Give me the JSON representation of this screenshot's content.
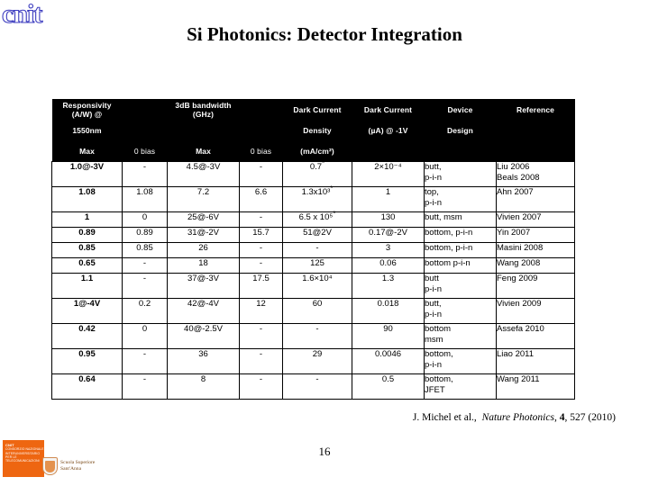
{
  "logo": {
    "brand_text": "cnit",
    "brand_color": "#4a4ac4",
    "orange_block_color": "#ee6611",
    "orange_lines": [
      "CNIT",
      "CONSORZIO NAZIONALE",
      "INTERUNIVERSITARIO",
      "PER LE",
      "TELECOMUNICAZIONI"
    ],
    "partner_name_line1": "Scuola Superiore",
    "partner_name_line2": "Sant'Anna"
  },
  "slide": {
    "title": "Si Photonics: Detector Integration",
    "page_number": "16"
  },
  "citation": {
    "authors": "J. Michel et al.,",
    "journal": "Nature Photonics",
    "volume": "4",
    "page": "527",
    "year": "(2010)",
    "separator_1": ", ",
    "separator_2": ", "
  },
  "table": {
    "header_bg": "#000000",
    "header_fg": "#ffffff",
    "header_rows": [
      [
        "Responsivity (A/W) @",
        "",
        "3dB bandwidth (GHz)",
        "",
        "Dark Current",
        "Dark Current",
        "Device",
        "Reference"
      ],
      [
        "1550nm",
        "",
        "",
        "",
        "Density",
        "(µA) @ -1V",
        "Design",
        ""
      ],
      [
        "Max",
        "0 bias",
        "Max",
        "0 bias",
        "(mA/cm²)",
        "",
        "",
        ""
      ]
    ],
    "rows": [
      {
        "responsivity_max": "1.0@-3V",
        "responsivity_0bias": "-",
        "bandwidth_max": "4.5@-3V",
        "bandwidth_0bias": "-",
        "dark_current_density": "0.7*",
        "dark_current_ua": "2×10⁻⁴",
        "device_design": "butt,\np-i-n",
        "reference": "Liu 2006\nBeals 2008",
        "tall": true
      },
      {
        "responsivity_max": "1.08",
        "responsivity_0bias": "1.08",
        "bandwidth_max": "7.2",
        "bandwidth_0bias": "6.6",
        "dark_current_density": "1.3x10³*",
        "dark_current_ua": "1",
        "device_design": "top,\np-i-n",
        "reference": "Ahn 2007",
        "tall": true
      },
      {
        "responsivity_max": "1",
        "responsivity_0bias": "0",
        "bandwidth_max": "25@-6V",
        "bandwidth_0bias": "-",
        "dark_current_density": "6.5 x 10⁵*",
        "dark_current_ua": "130",
        "device_design": "butt, msm",
        "reference": "Vivien 2007",
        "tall": false
      },
      {
        "responsivity_max": "0.89",
        "responsivity_0bias": "0.89",
        "bandwidth_max": "31@-2V",
        "bandwidth_0bias": "15.7",
        "dark_current_density": "51@2V",
        "dark_current_ua": "0.17@-2V",
        "device_design": "bottom, p-i-n",
        "reference": "Yin 2007",
        "tall": false
      },
      {
        "responsivity_max": "0.85",
        "responsivity_0bias": "0.85",
        "bandwidth_max": "26",
        "bandwidth_0bias": "-",
        "dark_current_density": "-",
        "dark_current_ua": "3",
        "device_design": "bottom, p-i-n",
        "reference": "Masini 2008",
        "tall": false
      },
      {
        "responsivity_max": "0.65",
        "responsivity_0bias": "-",
        "bandwidth_max": "18",
        "bandwidth_0bias": "-",
        "dark_current_density": "125",
        "dark_current_ua": "0.06",
        "device_design": "bottom p-i-n",
        "reference": "Wang 2008",
        "tall": false
      },
      {
        "responsivity_max": "1.1",
        "responsivity_0bias": "-",
        "bandwidth_max": "37@-3V",
        "bandwidth_0bias": "17.5",
        "dark_current_density": "1.6×10⁴",
        "dark_current_ua": "1.3",
        "device_design": "butt\np-i-n",
        "reference": "Feng 2009",
        "tall": true
      },
      {
        "responsivity_max": "1@-4V",
        "responsivity_0bias": "0.2",
        "bandwidth_max": "42@-4V",
        "bandwidth_0bias": "12",
        "dark_current_density": "60",
        "dark_current_ua": "0.018",
        "device_design": "butt,\np-i-n",
        "reference": "Vivien 2009",
        "tall": true
      },
      {
        "responsivity_max": "0.42",
        "responsivity_0bias": "0",
        "bandwidth_max": "40@-2.5V",
        "bandwidth_0bias": "-",
        "dark_current_density": "-",
        "dark_current_ua": "90",
        "device_design": "bottom\nmsm",
        "reference": "Assefa 2010",
        "tall": true
      },
      {
        "responsivity_max": "0.95",
        "responsivity_0bias": "-",
        "bandwidth_max": "36",
        "bandwidth_0bias": "-",
        "dark_current_density": "29",
        "dark_current_ua": "0.0046",
        "device_design": "bottom,\np-i-n",
        "reference": "Liao 2011",
        "tall": true
      },
      {
        "responsivity_max": "0.64",
        "responsivity_0bias": "-",
        "bandwidth_max": "8",
        "bandwidth_0bias": "-",
        "dark_current_density": "-",
        "dark_current_ua": "0.5",
        "device_design": "bottom,\nJFET",
        "reference": "Wang 2011",
        "tall": true
      }
    ]
  }
}
